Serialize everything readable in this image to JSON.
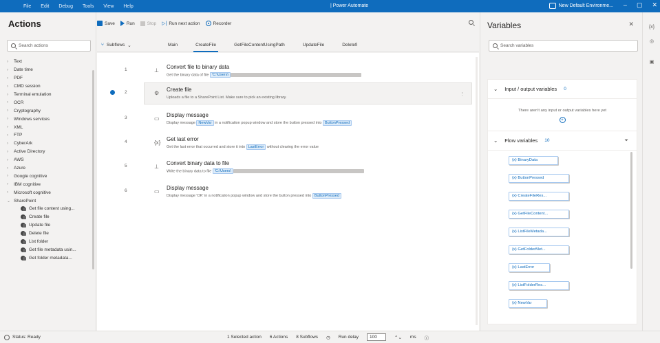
{
  "titlebar": {
    "menu": [
      "File",
      "Edit",
      "Debug",
      "Tools",
      "View",
      "Help"
    ],
    "title": "| Power Automate",
    "environment": "New Default Environme..."
  },
  "actions_pane": {
    "title": "Actions",
    "search_placeholder": "Search actions",
    "categories": [
      "Text",
      "Date time",
      "PDF",
      "CMD session",
      "Terminal emulation",
      "OCR",
      "Cryptography",
      "Windows services",
      "XML",
      "FTP",
      "CyberArk",
      "Active Directory",
      "AWS",
      "Azure",
      "Google cognitive",
      "IBM cognitive",
      "Microsoft cognitive"
    ],
    "expanded_category": "SharePoint",
    "sharepoint_items": [
      "Get file content using...",
      "Create file",
      "Update file",
      "Delete file",
      "List folder",
      "Get file metadata usin...",
      "Get folder metadata..."
    ]
  },
  "toolbar": {
    "save": "Save",
    "run": "Run",
    "stop": "Stop",
    "run_next": "Run next action",
    "recorder": "Recorder"
  },
  "tabs": {
    "subflows": "Subflows",
    "items": [
      "Main",
      "CreateFile",
      "GetFileContentUsingPath",
      "UpdateFile",
      "Deletefi"
    ],
    "active": "CreateFile"
  },
  "steps": [
    {
      "num": "1",
      "title": "Convert file to binary data",
      "desc_prefix": "Get the binary data of file",
      "path": "'C:\\Users\\",
      "icon": "⊥"
    },
    {
      "num": "2",
      "title": "Create file",
      "desc_prefix": "Uploads a file to a SharePoint List. Make sure to pick an existing library.",
      "icon": "⚙"
    },
    {
      "num": "3",
      "title": "Display message",
      "desc_prefix": "Display message",
      "var1": "NewVar",
      "desc_mid": "in a notification popup window and store the button pressed into",
      "var2": "ButtonPressed",
      "icon": "▭"
    },
    {
      "num": "4",
      "title": "Get last error",
      "desc_prefix": "Get the last error that occurred and store it into",
      "var1": "LastError",
      "desc_mid": "without clearing the error value",
      "icon": "{x}"
    },
    {
      "num": "5",
      "title": "Convert binary data to file",
      "desc_prefix": "Write the binary data to file",
      "path": "'C:\\Users\\",
      "icon": "⊥"
    },
    {
      "num": "6",
      "title": "Display message",
      "desc_prefix": "Display message 'OK' in a notification popup window and store the button pressed into",
      "var2": "ButtonPressed",
      "icon": "▭"
    }
  ],
  "statusbar": {
    "status": "Status: Ready",
    "selected": "1 Selected action",
    "actions": "6 Actions",
    "subflows": "8 Subflows",
    "run_delay_label": "Run delay",
    "run_delay_value": "100",
    "unit": "ms"
  },
  "variables": {
    "title": "Variables",
    "search_placeholder": "Search variables",
    "io_title": "Input / output variables",
    "io_count": "0",
    "io_empty": "There aren't any input or output variables here yet",
    "flow_title": "Flow variables",
    "flow_count": "10",
    "flow_vars": [
      "{x} BinaryData",
      "{x} ButtonPressed",
      "{x} CreateFileRes...",
      "{x} GetFileContent...",
      "{x} ListFileMetada...",
      "{x} GetFolderMet...",
      "{x} LastError",
      "{x} ListFolderRes...",
      "{x} NewVar"
    ]
  },
  "colors": {
    "accent": "#0f6cbd",
    "titlebar": "#0f6cbd"
  }
}
